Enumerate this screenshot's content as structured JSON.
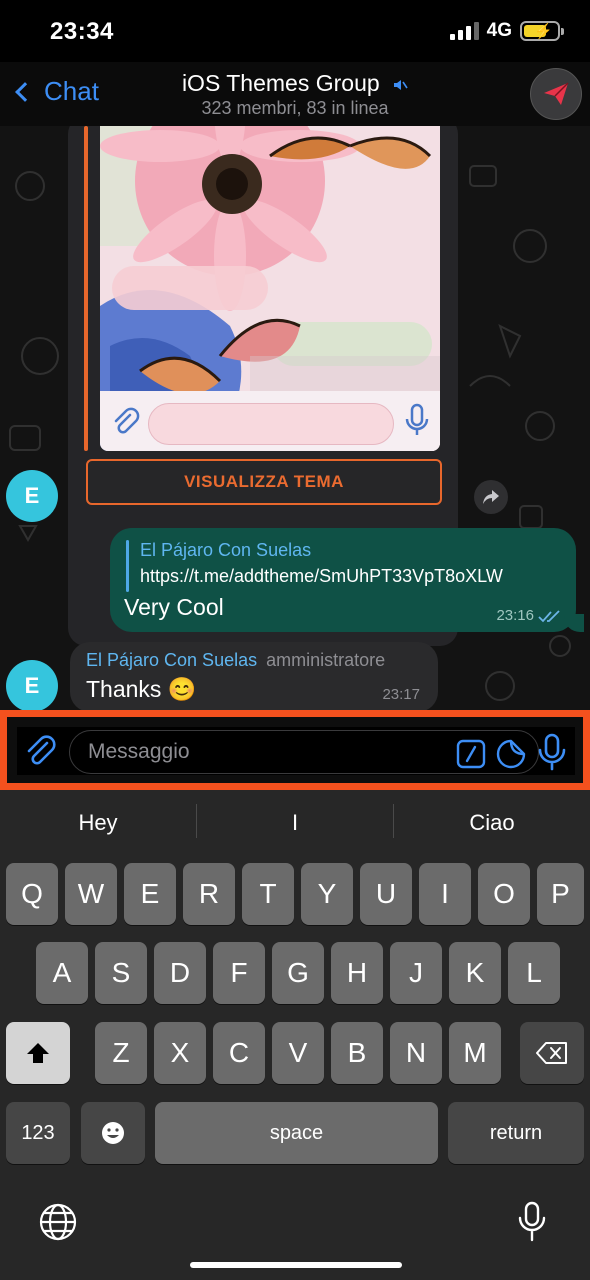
{
  "status": {
    "time": "23:34",
    "network": "4G"
  },
  "nav": {
    "back_label": "Chat",
    "title": "iOS Themes Group",
    "subtitle": "323 membri, 83 in linea"
  },
  "chat": {
    "theme_button": "VISUALIZZA TEMA",
    "messages": [
      {
        "direction": "out",
        "reply_name": "El Pájaro Con Suelas",
        "reply_text": "https://t.me/addtheme/SmUhPT33VpT8oXLW",
        "text": "Very Cool",
        "time": "23:16"
      },
      {
        "direction": "in",
        "avatar_letter": "E",
        "sender": "El Pájaro Con Suelas",
        "role": "amministratore",
        "text": "Thanks 😊",
        "time": "23:17"
      }
    ],
    "first_avatar_letter": "E"
  },
  "input": {
    "placeholder": "Messaggio"
  },
  "keyboard": {
    "suggestions": [
      "Hey",
      "I",
      "Ciao"
    ],
    "row1": [
      "Q",
      "W",
      "E",
      "R",
      "T",
      "Y",
      "U",
      "I",
      "O",
      "P"
    ],
    "row2": [
      "A",
      "S",
      "D",
      "F",
      "G",
      "H",
      "J",
      "K",
      "L"
    ],
    "row3": [
      "Z",
      "X",
      "C",
      "V",
      "B",
      "N",
      "M"
    ],
    "numbers_label": "123",
    "space_label": "space",
    "return_label": "return"
  },
  "colors": {
    "accent_blue": "#3d8ef5",
    "theme_orange": "#e8672c",
    "highlight_box": "#f4511e",
    "outgoing_bubble": "#0f5146",
    "avatar": "#35c5dd"
  }
}
